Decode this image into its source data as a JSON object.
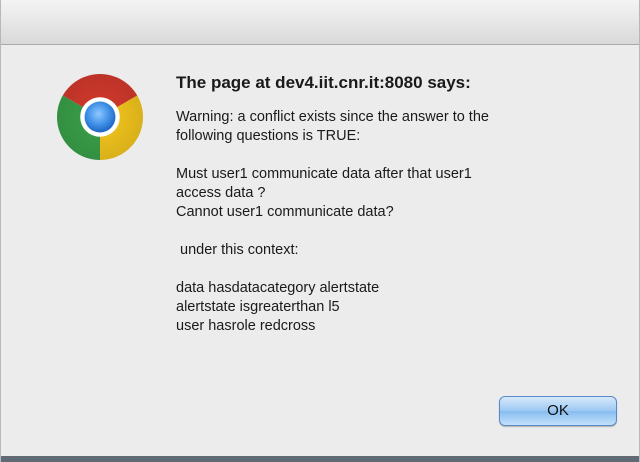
{
  "dialog": {
    "title": "The page at dev4.iit.cnr.it:8080 says:",
    "message_lines": [
      "Warning: a conflict exists since the answer to the",
      "following questions is TRUE:",
      "",
      "Must user1 communicate data after that user1",
      "access data ?",
      "Cannot user1 communicate data?",
      "",
      " under this context:",
      "",
      "data hasdatacategory alertstate",
      "alertstate isgreaterthan l5",
      "user hasrole redcross"
    ],
    "ok_label": "OK",
    "icon": "chrome-icon"
  }
}
